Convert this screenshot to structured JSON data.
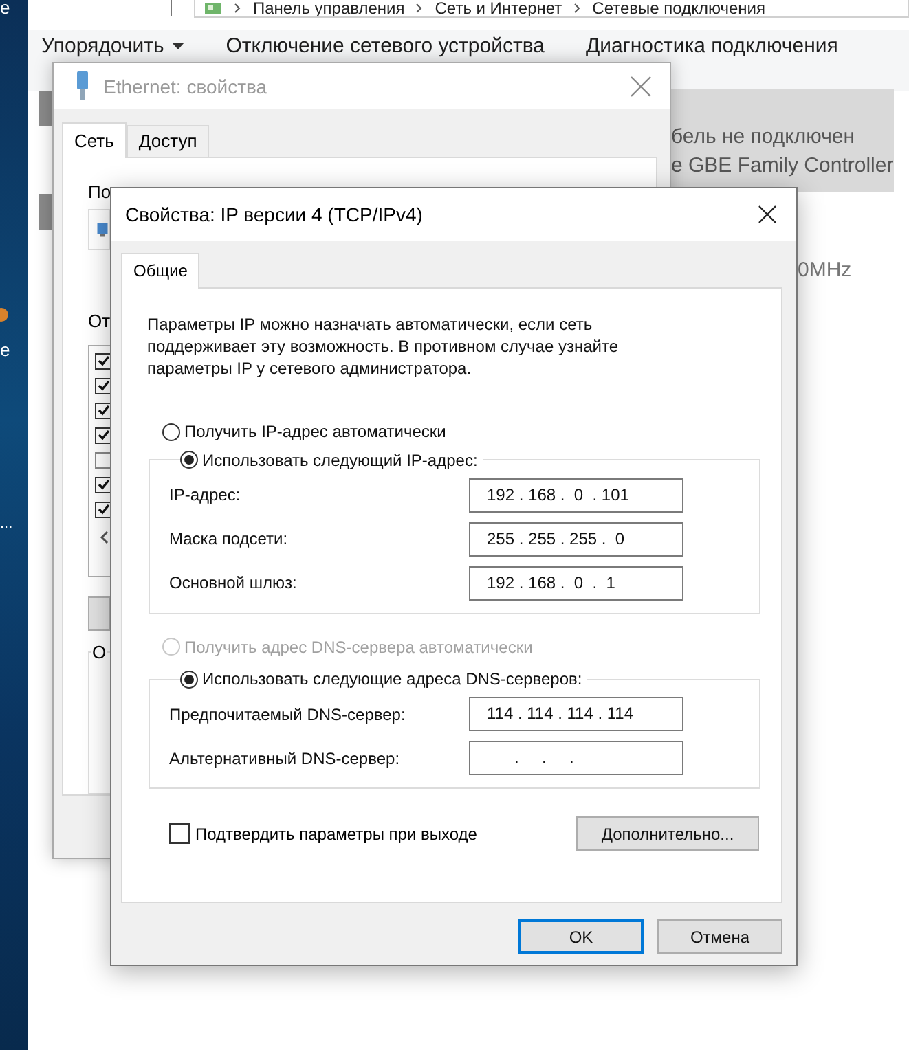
{
  "desktop": {
    "labels": [
      {
        "text": "e"
      },
      {
        "text": "e"
      },
      {
        "text": "..."
      }
    ]
  },
  "explorer": {
    "breadcrumb": [
      "Панель управления",
      "Сеть и Интернет",
      "Сетевые подключения"
    ],
    "toolbar": [
      {
        "label": "Упорядочить",
        "dropdown": true
      },
      {
        "label": "Отключение сетевого устройства",
        "dropdown": false
      },
      {
        "label": "Диагностика подключения",
        "dropdown": false
      }
    ],
    "adapter": {
      "status": "бель не подключен",
      "device": "e GBE Family Controller",
      "selected": true
    },
    "detail": "0MHz"
  },
  "ethernet_dialog": {
    "title": "Ethernet: свойства",
    "active": false,
    "tabs": [
      {
        "label": "Сеть",
        "selected": true
      },
      {
        "label": "Доступ",
        "selected": false
      }
    ],
    "connect_label": "По",
    "components_label": "От",
    "components": [
      {
        "checked": true
      },
      {
        "checked": true
      },
      {
        "checked": true
      },
      {
        "checked": true
      },
      {
        "checked": false
      },
      {
        "checked": true
      },
      {
        "checked": true
      }
    ],
    "description_label": "О"
  },
  "ip_dialog": {
    "title": "Свойства: IP версии 4 (TCP/IPv4)",
    "tabs": [
      {
        "label": "Общие",
        "selected": true
      }
    ],
    "intro": "Параметры IP можно назначать автоматически, если сеть поддерживает эту возможность. В противном случае узнайте параметры IP у сетевого администратора.",
    "ip_mode": [
      {
        "label": "Получить IP-адрес автоматически",
        "selected": false,
        "disabled": false
      },
      {
        "label": "Использовать следующий IP-адрес:",
        "selected": true,
        "disabled": false
      }
    ],
    "ip_fields": [
      {
        "label": "IP-адрес:",
        "value": "192 . 168 .  0  . 101"
      },
      {
        "label": "Маска подсети:",
        "value": "255 . 255 . 255 .  0"
      },
      {
        "label": "Основной шлюз:",
        "value": "192 . 168 .  0  .  1"
      }
    ],
    "dns_mode": [
      {
        "label": "Получить адрес DNS-сервера автоматически",
        "selected": false,
        "disabled": true
      },
      {
        "label": "Использовать следующие адреса DNS-серверов:",
        "selected": true,
        "disabled": false
      }
    ],
    "dns_fields": [
      {
        "label": "Предпочитаемый DNS-сервер:",
        "value": "114 . 114 . 114 . 114"
      },
      {
        "label": "Альтернативный DNS-сервер:",
        "value": "      .     .     ."
      }
    ],
    "confirm": {
      "label": "Подтвердить параметры при выходе",
      "checked": false
    },
    "advanced_button": "Дополнительно...",
    "buttons": [
      {
        "label": "OK",
        "default": true
      },
      {
        "label": "Отмена",
        "default": false
      }
    ]
  }
}
